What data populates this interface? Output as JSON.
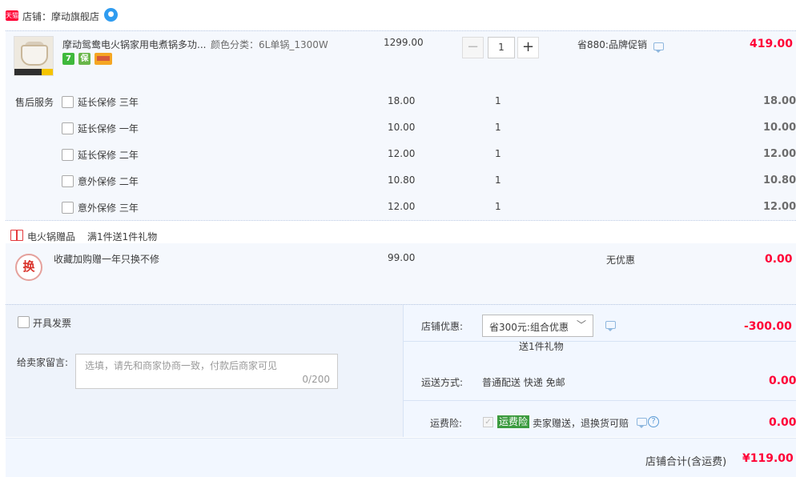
{
  "shop": {
    "badge": "天猫",
    "name_label": "店铺：摩动旗舰店"
  },
  "item": {
    "title": "摩动鸳鸯电火锅家用电煮锅多功...",
    "sku": "颜色分类：6L单锅_1300W",
    "unit_price": "1299.00",
    "quantity": "1",
    "promo": "省880:品牌促销",
    "total": "419.00",
    "service_icons": [
      "7",
      "保",
      "卡"
    ],
    "service_colors": [
      "#3fb93c",
      "#69b64a",
      "#f5a623"
    ]
  },
  "after_sales": {
    "label": "售后服务",
    "options": [
      {
        "name": "延长保修 三年",
        "price": "18.00",
        "qty": "1",
        "total": "18.00"
      },
      {
        "name": "延长保修 一年",
        "price": "10.00",
        "qty": "1",
        "total": "10.00"
      },
      {
        "name": "延长保修 二年",
        "price": "12.00",
        "qty": "1",
        "total": "12.00"
      },
      {
        "name": "意外保修 二年",
        "price": "10.80",
        "qty": "1",
        "total": "10.80"
      },
      {
        "name": "意外保修 三年",
        "price": "12.00",
        "qty": "1",
        "total": "12.00"
      }
    ]
  },
  "gift": {
    "header_label": "电火锅赠品",
    "header_rule": "满1件送1件礼物",
    "icon_char": "换",
    "name": "收藏加购赠一年只换不修",
    "price": "99.00",
    "discount": "无优惠",
    "total": "0.00"
  },
  "order": {
    "invoice_label": "开具发票",
    "memo_label": "给卖家留言:",
    "memo_placeholder": "选填，请先和商家协商一致，付款后商家可见",
    "memo_count": "0/200",
    "shop_discount_label": "店铺优惠:",
    "shop_discount_value": "省300元:组合优惠",
    "shop_discount_sub": "送1件礼物",
    "shop_discount_amount": "-300.00",
    "shipping_label": "运送方式:",
    "shipping_value": "普通配送 快递 免邮",
    "shipping_amount": "0.00",
    "insurance_label": "运费险:",
    "insurance_tag": "运费险",
    "insurance_text": "卖家赠送，退换货可赔",
    "insurance_amount": "0.00",
    "total_label": "店铺合计(含运费)",
    "total_value": "¥119.00"
  },
  "colors": {
    "accent_red": "#ff0036",
    "panel_bg": "#f2f7ff",
    "item_bg": "#f5f8fd"
  }
}
